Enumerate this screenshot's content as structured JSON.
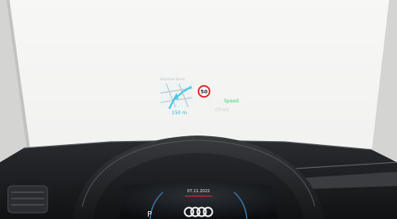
{
  "hud": {
    "nav_street_label": "Example Street",
    "nav_distance": "150 m",
    "speed_limit": "50",
    "current_speed_label": "Speed",
    "assist_label": "Ghost"
  },
  "cluster": {
    "date_label": "07.11.2022",
    "gear_label": "P",
    "nav_label": "Navigation",
    "brand": "four-rings-logo"
  },
  "colors": {
    "windshield": "#f3f3f2",
    "frame": "#cfcfcf",
    "dash_dark": "#1d1e20",
    "hud_green": "#3fd07a",
    "hud_cyan": "#20c6e6",
    "speed_ring": "#e0262c"
  }
}
